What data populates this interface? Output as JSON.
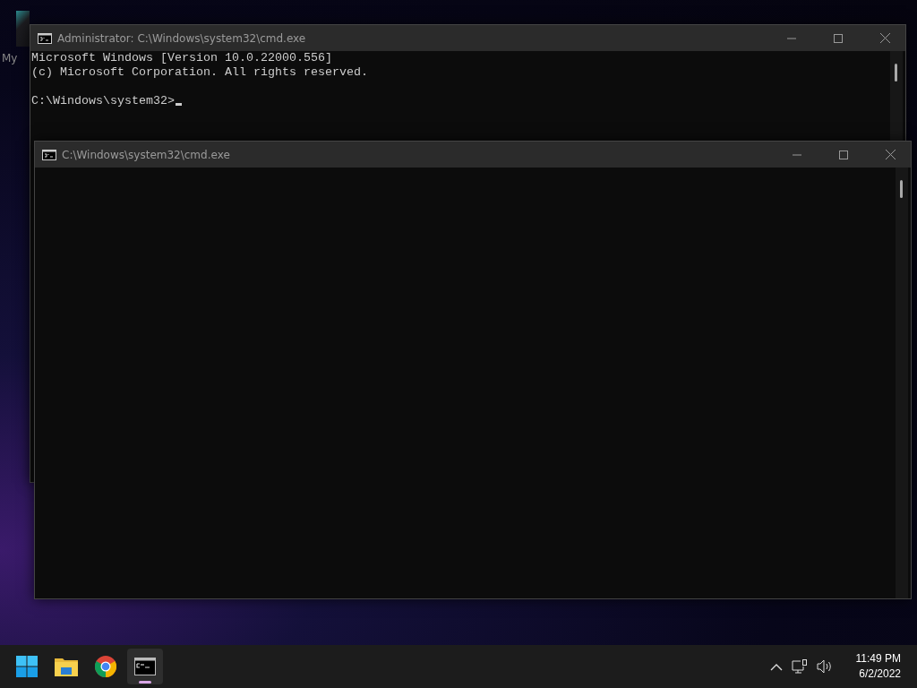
{
  "desktop": {
    "icons": [
      {
        "label": "My"
      }
    ]
  },
  "windows": [
    {
      "title": "Administrator: C:\\Windows\\system32\\cmd.exe",
      "lines": [
        "Microsoft Windows [Version 10.0.22000.556]",
        "(c) Microsoft Corporation. All rights reserved."
      ],
      "prompt": "C:\\Windows\\system32>",
      "cursor": true
    },
    {
      "title": "C:\\Windows\\system32\\cmd.exe"
    }
  ],
  "taskbar": {
    "apps": [
      {
        "kind": "start",
        "active": false
      },
      {
        "kind": "explorer",
        "active": false
      },
      {
        "kind": "chrome",
        "active": false
      },
      {
        "kind": "terminal",
        "active": true
      }
    ],
    "tray": {
      "time": "11:49 PM",
      "date": "6/2/2022"
    }
  }
}
